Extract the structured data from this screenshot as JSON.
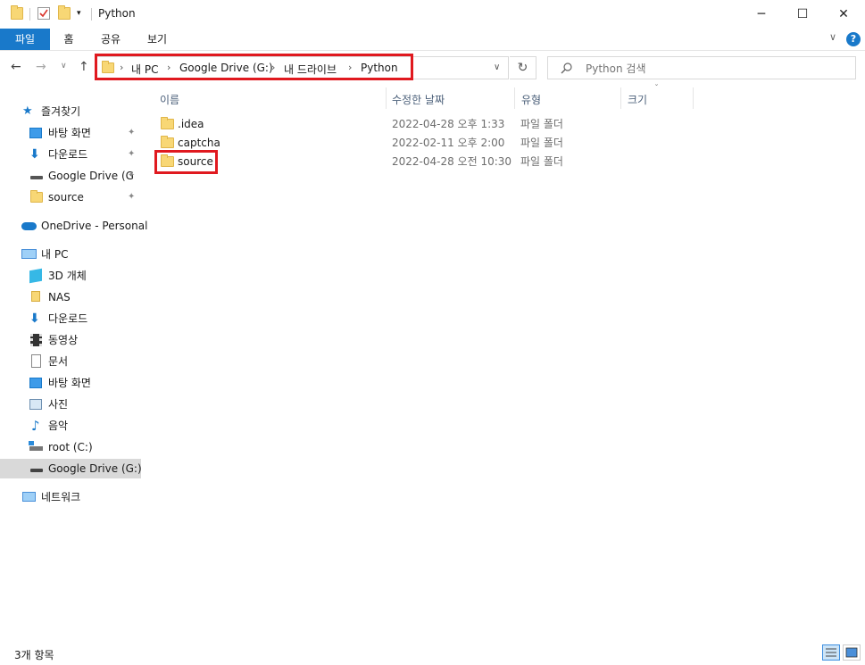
{
  "window": {
    "title": "Python",
    "minimize": "─",
    "maximize": "☐",
    "close": "✕"
  },
  "ribbon": {
    "tabs": [
      "파일",
      "홈",
      "공유",
      "보기"
    ],
    "collapse": "∨",
    "help": "?"
  },
  "nav": {
    "back": "←",
    "forward": "→",
    "recent": "∨",
    "up": "↑",
    "breadcrumb": [
      "내 PC",
      "Google Drive (G:)",
      "내 드라이브",
      "Python"
    ],
    "sep": "›",
    "dropdown": "∨",
    "refresh": "↻",
    "search_placeholder": "Python 검색"
  },
  "sidebar": {
    "items": [
      {
        "label": "즐겨찾기",
        "icon": "star-icon"
      },
      {
        "label": "바탕 화면",
        "icon": "desktop-icon",
        "pinned": true
      },
      {
        "label": "다운로드",
        "icon": "download-icon",
        "pinned": true
      },
      {
        "label": "Google Drive (G",
        "icon": "drive-icon",
        "pinned": true
      },
      {
        "label": "source",
        "icon": "cloud-folder-icon",
        "pinned": true
      },
      {
        "label": "OneDrive - Personal",
        "icon": "onedrive-icon"
      },
      {
        "label": "내 PC",
        "icon": "pc-icon"
      },
      {
        "label": "3D 개체",
        "icon": "cube-icon"
      },
      {
        "label": "NAS",
        "icon": "nas-icon"
      },
      {
        "label": "다운로드",
        "icon": "download-icon"
      },
      {
        "label": "동영상",
        "icon": "video-icon"
      },
      {
        "label": "문서",
        "icon": "document-icon"
      },
      {
        "label": "바탕 화면",
        "icon": "desktop-icon"
      },
      {
        "label": "사진",
        "icon": "pictures-icon"
      },
      {
        "label": "음악",
        "icon": "music-icon"
      },
      {
        "label": "root (C:)",
        "icon": "drive-c-icon"
      },
      {
        "label": "Google Drive (G:)",
        "icon": "drive-icon",
        "selected": true
      },
      {
        "label": "네트워크",
        "icon": "network-icon"
      }
    ],
    "pin_glyph": "📌"
  },
  "columns": {
    "name": "이름",
    "date": "수정한 날짜",
    "type": "유형",
    "size": "크기",
    "sort_indicator": "ˇ"
  },
  "files": [
    {
      "name": ".idea",
      "date": "2022-04-28 오후 1:33",
      "type": "파일 폴더"
    },
    {
      "name": "captcha",
      "date": "2022-02-11 오후 2:00",
      "type": "파일 폴더"
    },
    {
      "name": "source",
      "date": "2022-04-28 오전 10:30",
      "type": "파일 폴더"
    }
  ],
  "status": {
    "count": "3개 항목"
  },
  "colors": {
    "accent": "#1979ca",
    "highlight": "#e0191f",
    "folder": "#f8d775"
  }
}
